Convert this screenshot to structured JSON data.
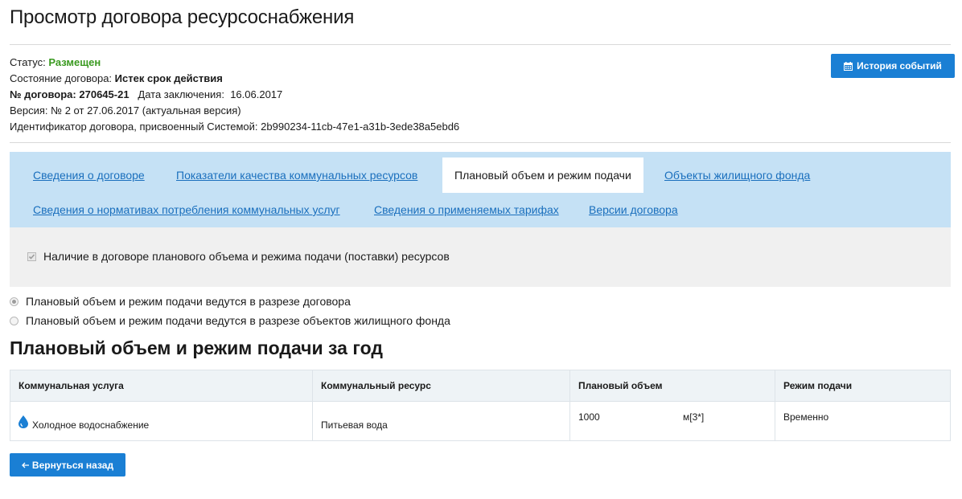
{
  "page": {
    "title": "Просмотр договора ресурсоснабжения"
  },
  "info": {
    "status_label": "Статус:",
    "status_value": "Размещен",
    "state_label": "Состояние договора:",
    "state_value": "Истек срок действия",
    "number_label": "№ договора:",
    "number_value": "270645-21",
    "date_label": "Дата заключения:",
    "date_value": "16.06.2017",
    "version_text": "Версия: № 2 от 27.06.2017 (актуальная версия)",
    "id_label": "Идентификатор договора, присвоенный Системой:",
    "id_value": "2b990234-11cb-47e1-a31b-3ede38a5ebd6"
  },
  "toolbar": {
    "history_label": "История событий"
  },
  "tabs": [
    {
      "label": "Сведения о договоре",
      "active": false
    },
    {
      "label": "Показатели качества коммунальных ресурсов",
      "active": false
    },
    {
      "label": "Плановый объем и режим подачи",
      "active": true
    },
    {
      "label": "Объекты жилищного фонда",
      "active": false
    },
    {
      "label": "Сведения о нормативах потребления коммунальных услуг",
      "active": false
    },
    {
      "label": "Сведения о применяемых тарифах",
      "active": false
    },
    {
      "label": "Версии договора",
      "active": false
    }
  ],
  "panel": {
    "checkbox_label": "Наличие в договоре планового объема и режима подачи (поставки) ресурсов",
    "checkbox_checked": true
  },
  "options": [
    {
      "label": "Плановый объем и режим подачи ведутся в разрезе договора",
      "checked": true
    },
    {
      "label": "Плановый объем и режим подачи ведутся в разрезе объектов жилищного фонда",
      "checked": false
    }
  ],
  "section": {
    "title": "Плановый объем и режим подачи за год"
  },
  "table": {
    "headers": [
      "Коммунальная услуга",
      "Коммунальный ресурс",
      "Плановый объем",
      "Режим подачи"
    ],
    "rows": [
      {
        "service": "Холодное водоснабжение",
        "resource": "Питьевая вода",
        "volume": "1000",
        "unit": "м[3*]",
        "mode": "Временно"
      }
    ]
  },
  "footer": {
    "back_label": "Вернуться назад"
  },
  "colors": {
    "accent": "#1a7fd4",
    "status_green": "#3a9a20",
    "tab_bg": "#c5e1f5",
    "link": "#1a6fbd"
  }
}
